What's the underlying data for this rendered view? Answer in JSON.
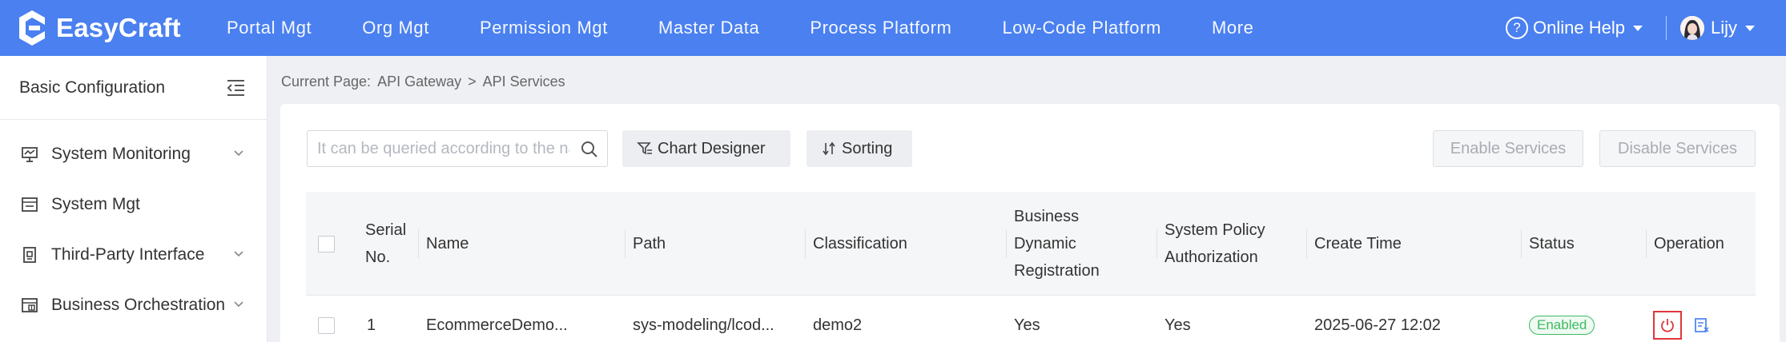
{
  "header": {
    "app_name": "EasyCraft",
    "nav": [
      "Portal Mgt",
      "Org Mgt",
      "Permission Mgt",
      "Master Data",
      "Process Platform",
      "Low-Code Platform",
      "More"
    ],
    "help_label": "Online Help",
    "help_icon": "question-circle-icon",
    "user_name": "Lijy",
    "brand_color": "#4a80f0"
  },
  "sidebar": {
    "title": "Basic Configuration",
    "items": [
      {
        "label": "System Monitoring",
        "icon": "monitor-icon",
        "expandable": true
      },
      {
        "label": "System Mgt",
        "icon": "window-icon",
        "expandable": false
      },
      {
        "label": "Third-Party Interface",
        "icon": "interface-icon",
        "expandable": true
      },
      {
        "label": "Business Orchestration",
        "icon": "orchestration-icon",
        "expandable": true
      }
    ]
  },
  "breadcrumb": {
    "prefix": "Current Page:",
    "items": [
      "API Gateway",
      ">",
      "API Services"
    ]
  },
  "toolbar": {
    "search_placeholder": "It can be queried according to the name",
    "chart_designer": "Chart Designer",
    "sorting": "Sorting",
    "enable_services": "Enable Services",
    "disable_services": "Disable Services"
  },
  "table": {
    "headers": {
      "serial_1": "Serial",
      "serial_2": "No.",
      "name": "Name",
      "path": "Path",
      "classification": "Classification",
      "bdr_1": "Business",
      "bdr_2": "Dynamic",
      "bdr_3": "Registration",
      "spa_1": "System Policy",
      "spa_2": "Authorization",
      "create_time": "Create Time",
      "status": "Status",
      "operation": "Operation"
    },
    "rows": [
      {
        "serial": "1",
        "name": "EcommerceDemo...",
        "path": "sys-modeling/lcod...",
        "classification": "demo2",
        "business_dynamic_registration": "Yes",
        "system_policy_authorization": "Yes",
        "create_time": "2025-06-27 12:02",
        "status": "Enabled",
        "status_color": "#3fba62"
      }
    ]
  }
}
